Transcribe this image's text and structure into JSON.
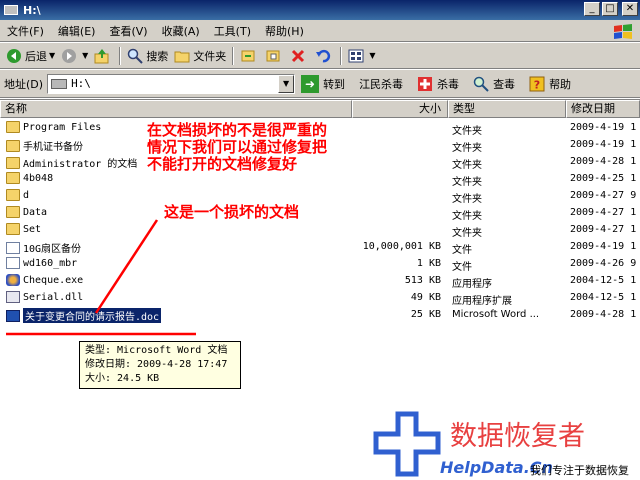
{
  "window": {
    "title": "H:\\"
  },
  "menu": [
    "文件(F)",
    "编辑(E)",
    "查看(V)",
    "收藏(A)",
    "工具(T)",
    "帮助(H)"
  ],
  "toolbar": {
    "back": "后退",
    "search": "搜索",
    "folders": "文件夹"
  },
  "address": {
    "label": "地址(D)",
    "value": "H:\\",
    "go": "转到",
    "jiangmin": "江民杀毒",
    "antivirus": "杀毒",
    "check": "查毒",
    "help": "帮助"
  },
  "columns": {
    "name": "名称",
    "size": "大小",
    "type": "类型",
    "date": "修改日期"
  },
  "files": [
    {
      "name": "Program Files",
      "size": "",
      "type": "文件夹",
      "date": "2009-4-19 1",
      "icon": "folder-icon"
    },
    {
      "name": "手机证书备份",
      "size": "",
      "type": "文件夹",
      "date": "2009-4-19 1",
      "icon": "folder-icon"
    },
    {
      "name": "Administrator 的文档",
      "size": "",
      "type": "文件夹",
      "date": "2009-4-28 1",
      "icon": "folder-icon"
    },
    {
      "name": "4b048",
      "size": "",
      "type": "文件夹",
      "date": "2009-4-25 1",
      "icon": "folder-icon"
    },
    {
      "name": "d",
      "size": "",
      "type": "文件夹",
      "date": "2009-4-27 9",
      "icon": "folder-icon"
    },
    {
      "name": "Data",
      "size": "",
      "type": "文件夹",
      "date": "2009-4-27 1",
      "icon": "folder-icon"
    },
    {
      "name": "Set",
      "size": "",
      "type": "文件夹",
      "date": "2009-4-27 1",
      "icon": "folder-icon"
    },
    {
      "name": "10G扇区备份",
      "size": "10,000,001 KB",
      "type": "文件",
      "date": "2009-4-19 1",
      "icon": "file-icon"
    },
    {
      "name": "wd160_mbr",
      "size": "1 KB",
      "type": "文件",
      "date": "2009-4-26 9",
      "icon": "file-icon"
    },
    {
      "name": "Cheque.exe",
      "size": "513 KB",
      "type": "应用程序",
      "date": "2004-12-5 1",
      "icon": "exe-icon"
    },
    {
      "name": "Serial.dll",
      "size": "49 KB",
      "type": "应用程序扩展",
      "date": "2004-12-5 1",
      "icon": "dll-icon"
    },
    {
      "name": "关于变更合同的请示报告.doc",
      "size": "25 KB",
      "type": "Microsoft Word ...",
      "date": "2009-4-28 1",
      "icon": "word-doc-icon"
    }
  ],
  "annotations": {
    "top": [
      "在文档损坏的不是很严重的",
      "情况下我们可以通过修复把",
      "不能打开的文档修复好"
    ],
    "arrow_label": "这是一个损坏的文档"
  },
  "tooltip": {
    "type": "类型: Microsoft Word 文档",
    "modified": "修改日期: 2009-4-28 17:47",
    "size": "大小: 24.5 KB"
  },
  "watermark": {
    "title": "数据恢复者",
    "url": "HelpData.Cn",
    "slogan": "我们专注于数据恢复"
  },
  "colors": {
    "annotation": "#ff0000",
    "selection": "#0a246a",
    "tooltip_bg": "#ffffe1"
  }
}
